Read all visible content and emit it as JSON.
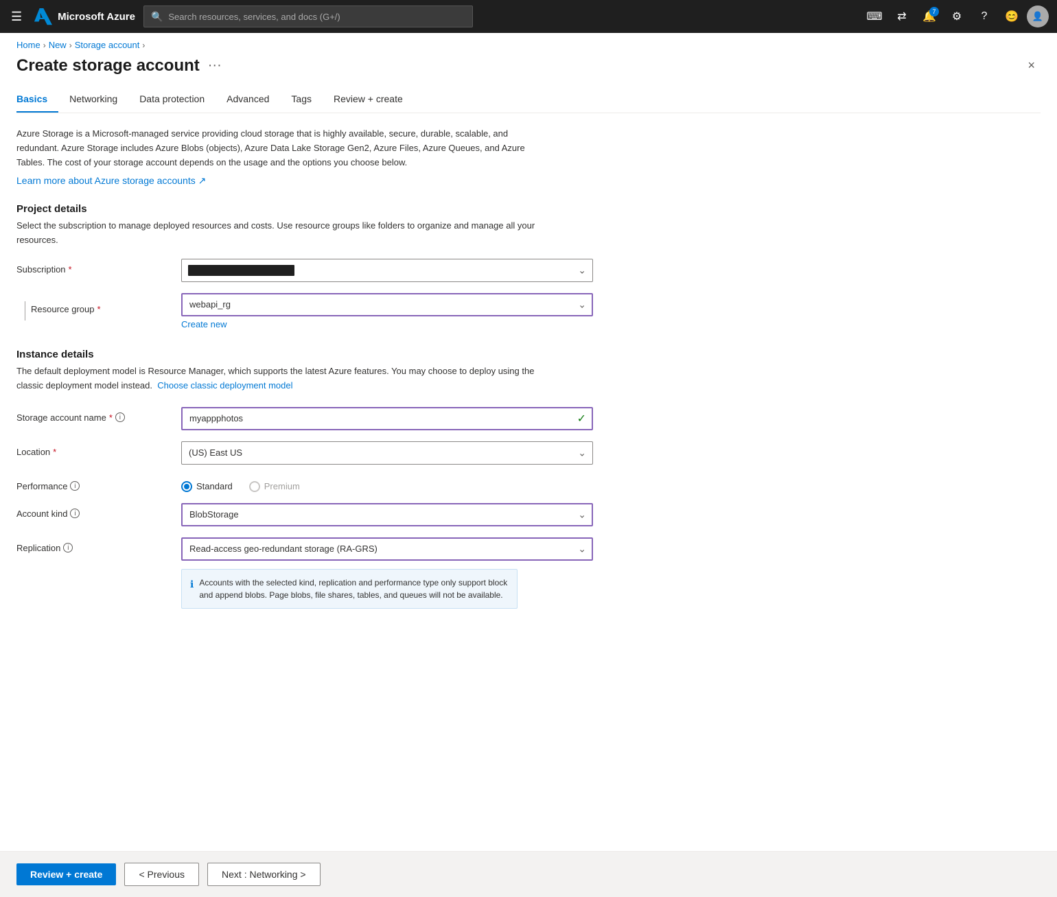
{
  "topbar": {
    "logo_text": "Microsoft Azure",
    "search_placeholder": "Search resources, services, and docs (G+/)",
    "notification_count": "7"
  },
  "breadcrumb": {
    "items": [
      "Home",
      "New",
      "Storage account"
    ]
  },
  "page": {
    "title": "Create storage account",
    "close_label": "×",
    "menu_dots": "···"
  },
  "tabs": [
    {
      "label": "Basics",
      "active": true
    },
    {
      "label": "Networking",
      "active": false
    },
    {
      "label": "Data protection",
      "active": false
    },
    {
      "label": "Advanced",
      "active": false
    },
    {
      "label": "Tags",
      "active": false
    },
    {
      "label": "Review + create",
      "active": false
    }
  ],
  "description": {
    "text": "Azure Storage is a Microsoft-managed service providing cloud storage that is highly available, secure, durable, scalable, and redundant. Azure Storage includes Azure Blobs (objects), Azure Data Lake Storage Gen2, Azure Files, Azure Queues, and Azure Tables. The cost of your storage account depends on the usage and the options you choose below.",
    "link_text": "Learn more about Azure storage accounts",
    "link_icon": "↗"
  },
  "project_details": {
    "title": "Project details",
    "subtitle": "Select the subscription to manage deployed resources and costs. Use resource groups like folders to organize and manage all your resources.",
    "subscription_label": "Subscription",
    "subscription_value": "",
    "resource_group_label": "Resource group",
    "resource_group_value": "webapi_rg",
    "resource_group_options": [
      "webapi_rg"
    ],
    "create_new_label": "Create new"
  },
  "instance_details": {
    "title": "Instance details",
    "subtitle_text": "The default deployment model is Resource Manager, which supports the latest Azure features. You may choose to deploy using the classic deployment model instead.",
    "classic_link": "Choose classic deployment model",
    "storage_account_name_label": "Storage account name",
    "storage_account_name_value": "myappphotos",
    "storage_account_name_valid": true,
    "location_label": "Location",
    "location_value": "(US) East US",
    "location_options": [
      "(US) East US"
    ],
    "performance_label": "Performance",
    "performance_options": [
      {
        "label": "Standard",
        "checked": true,
        "disabled": false
      },
      {
        "label": "Premium",
        "checked": false,
        "disabled": true
      }
    ],
    "account_kind_label": "Account kind",
    "account_kind_value": "BlobStorage",
    "account_kind_options": [
      "BlobStorage"
    ],
    "replication_label": "Replication",
    "replication_value": "Read-access geo-redundant storage (RA-GRS)",
    "replication_options": [
      "Read-access geo-redundant storage (RA-GRS)"
    ],
    "info_message": "Accounts with the selected kind, replication and performance type only support block and append blobs. Page blobs, file shares, tables, and queues will not be available."
  },
  "footer": {
    "review_create_label": "Review + create",
    "previous_label": "< Previous",
    "next_label": "Next : Networking >"
  }
}
